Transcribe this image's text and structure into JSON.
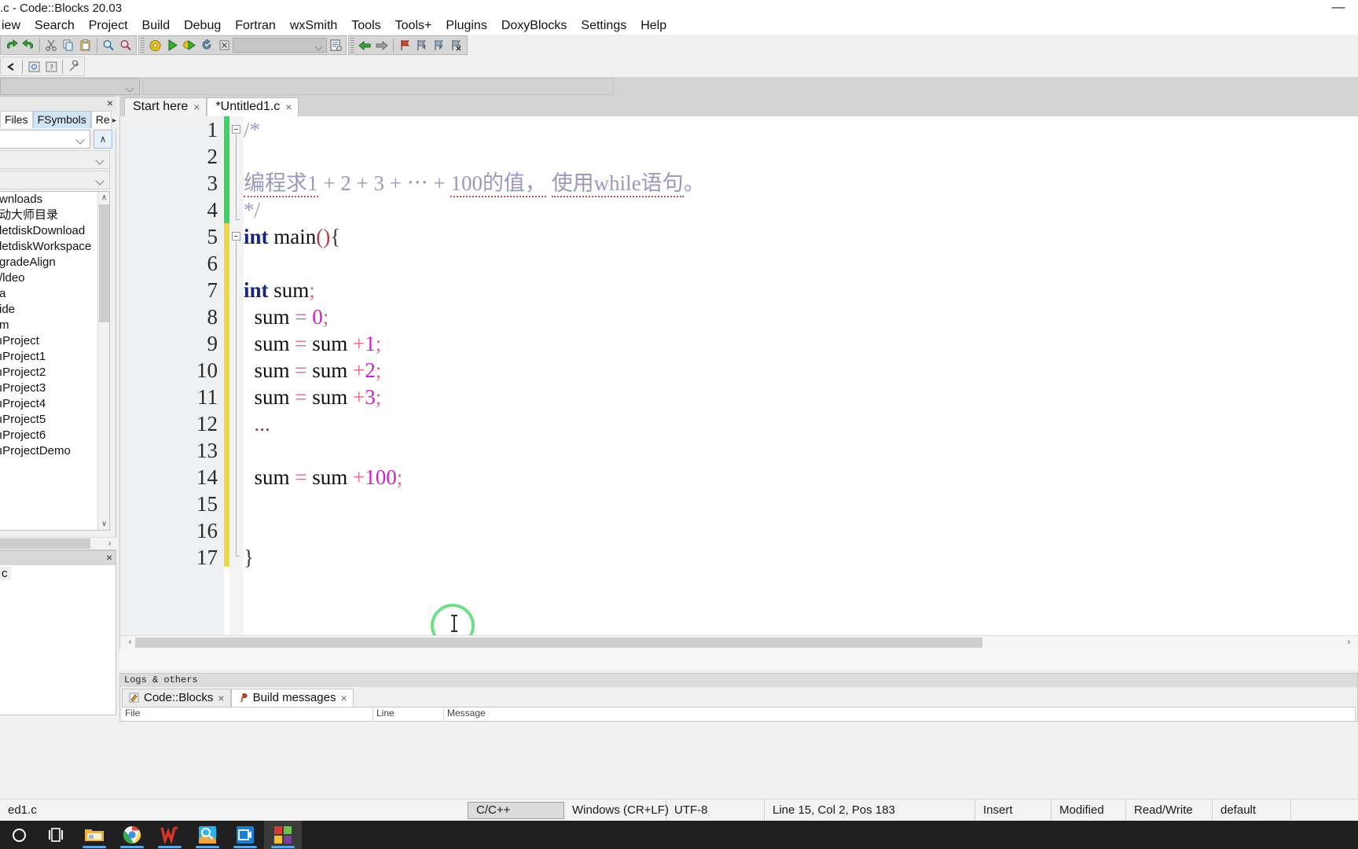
{
  "window": {
    "title": ".c - Code::Blocks 20.03",
    "minimize_label": "—"
  },
  "menubar": {
    "items": [
      {
        "label": "iew"
      },
      {
        "label": "Search"
      },
      {
        "label": "Project"
      },
      {
        "label": "Build"
      },
      {
        "label": "Debug"
      },
      {
        "label": "Fortran"
      },
      {
        "label": "wxSmith"
      },
      {
        "label": "Tools"
      },
      {
        "label": "Tools+"
      },
      {
        "label": "Plugins"
      },
      {
        "label": "DoxyBlocks"
      },
      {
        "label": "Settings"
      },
      {
        "label": "Help"
      }
    ]
  },
  "toolbar": {
    "main_icons": [
      "undo-icon",
      "redo-icon",
      "cut-icon",
      "copy-icon",
      "paste-icon",
      "find-icon",
      "replace-icon"
    ],
    "build_icons": [
      "build-icon",
      "run-icon",
      "build-and-run-icon",
      "rebuild-icon",
      "abort-icon"
    ],
    "build_target_value": "",
    "build_target_icon": "build-targets-icon",
    "nav_icons": [
      "back-icon",
      "forward-icon"
    ],
    "bookmark_icons": [
      "toggle-bookmark-icon",
      "previous-bookmark-icon",
      "next-bookmark-icon",
      "clear-bookmarks-icon"
    ],
    "row2_icons": [
      "debug-continue-icon",
      "debug-info-icon",
      "debug-help-icon",
      "debug-tools-icon"
    ]
  },
  "combo_row": {
    "scope_value": "",
    "function_value": ""
  },
  "management_panel": {
    "caption": "",
    "close_label": "×",
    "tabs": [
      {
        "label": "Files",
        "selected": false
      },
      {
        "label": "FSymbols",
        "selected": true
      },
      {
        "label": "Re",
        "selected": false
      }
    ],
    "scroll_more": "▸",
    "up_button_label": "∧",
    "combo_values": [
      "",
      "",
      ""
    ],
    "tree_items": [
      {
        "label": ""
      },
      {
        "label": "wnloads"
      },
      {
        "label": "动大师目录"
      },
      {
        "label": ""
      },
      {
        "label": "letdiskDownload"
      },
      {
        "label": "letdiskWorkspace"
      },
      {
        "label": "gradeAlign"
      },
      {
        "label": ""
      },
      {
        "label": "/ldeo"
      },
      {
        "label": "a"
      },
      {
        "label": "ide"
      },
      {
        "label": ""
      },
      {
        "label": "m"
      },
      {
        "label": "ıProject"
      },
      {
        "label": "ıProject1"
      },
      {
        "label": "ıProject2"
      },
      {
        "label": "ıProject3"
      },
      {
        "label": "ıProject4"
      },
      {
        "label": "ıProject5"
      },
      {
        "label": "ıProject6"
      },
      {
        "label": "ıProjectDemo"
      }
    ],
    "scroll_up": "∧",
    "scroll_down": "∨",
    "scroll_right": "›"
  },
  "lower_panel": {
    "close_label": "×",
    "item_label": "c"
  },
  "editor": {
    "tabs": [
      {
        "label": "Start here",
        "close": "×",
        "selected": false
      },
      {
        "label": "*Untitled1.c",
        "close": "×",
        "selected": true
      }
    ],
    "fold_markers": [
      1,
      5
    ],
    "change_bar": {
      "saved_color": "#3ad364",
      "unsaved_color": "#ecd844"
    },
    "lines": [
      {
        "n": "1",
        "tokens": [
          {
            "t": "/*",
            "c": "c-comment"
          }
        ]
      },
      {
        "n": "2",
        "tokens": []
      },
      {
        "n": "3",
        "tokens": [
          {
            "t": "编程求1",
            "c": "c-comment squig"
          },
          {
            "t": " + ",
            "c": "c-comment"
          },
          {
            "t": "2",
            "c": "c-comment"
          },
          {
            "t": " + ",
            "c": "c-comment"
          },
          {
            "t": "3",
            "c": "c-comment"
          },
          {
            "t": " + ",
            "c": "c-comment"
          },
          {
            "t": "⋯",
            "c": "c-comment"
          },
          {
            "t": " + ",
            "c": "c-comment"
          },
          {
            "t": "100的值，",
            "c": "c-comment squig"
          },
          {
            "t": " ",
            "c": "c-comment"
          },
          {
            "t": "使用while语句",
            "c": "c-comment squig"
          },
          {
            "t": "。",
            "c": "c-comment"
          }
        ]
      },
      {
        "n": "4",
        "tokens": [
          {
            "t": "*/",
            "c": "c-comment"
          }
        ]
      },
      {
        "n": "5",
        "tokens": [
          {
            "t": "int",
            "c": "c-kw"
          },
          {
            "t": " main",
            "c": "c-ident"
          },
          {
            "t": "()",
            "c": "c-paren"
          },
          {
            "t": "{",
            "c": "c-brace"
          }
        ]
      },
      {
        "n": "6",
        "tokens": []
      },
      {
        "n": "7",
        "tokens": [
          {
            "t": "int",
            "c": "c-kw"
          },
          {
            "t": " sum",
            "c": "c-ident"
          },
          {
            "t": ";",
            "c": "c-op"
          }
        ]
      },
      {
        "n": "8",
        "tokens": [
          {
            "t": "  sum ",
            "c": "c-ident"
          },
          {
            "t": "= ",
            "c": "c-op"
          },
          {
            "t": "0",
            "c": "c-num"
          },
          {
            "t": ";",
            "c": "c-op"
          }
        ]
      },
      {
        "n": "9",
        "tokens": [
          {
            "t": "  sum ",
            "c": "c-ident"
          },
          {
            "t": "= ",
            "c": "c-op"
          },
          {
            "t": "sum ",
            "c": "c-ident"
          },
          {
            "t": "+",
            "c": "c-op"
          },
          {
            "t": "1",
            "c": "c-num"
          },
          {
            "t": ";",
            "c": "c-op"
          }
        ]
      },
      {
        "n": "10",
        "tokens": [
          {
            "t": "  sum ",
            "c": "c-ident"
          },
          {
            "t": "= ",
            "c": "c-op"
          },
          {
            "t": "sum ",
            "c": "c-ident"
          },
          {
            "t": "+",
            "c": "c-op"
          },
          {
            "t": "2",
            "c": "c-num"
          },
          {
            "t": ";",
            "c": "c-op"
          }
        ]
      },
      {
        "n": "11",
        "tokens": [
          {
            "t": "  sum ",
            "c": "c-ident"
          },
          {
            "t": "= ",
            "c": "c-op"
          },
          {
            "t": "sum ",
            "c": "c-ident"
          },
          {
            "t": "+",
            "c": "c-op"
          },
          {
            "t": "3",
            "c": "c-num"
          },
          {
            "t": ";",
            "c": "c-op"
          }
        ]
      },
      {
        "n": "12",
        "tokens": [
          {
            "t": "  ...",
            "c": "c-dots"
          }
        ]
      },
      {
        "n": "13",
        "tokens": []
      },
      {
        "n": "14",
        "tokens": [
          {
            "t": "  sum ",
            "c": "c-ident"
          },
          {
            "t": "= ",
            "c": "c-op"
          },
          {
            "t": "sum ",
            "c": "c-ident"
          },
          {
            "t": "+",
            "c": "c-op"
          },
          {
            "t": "100",
            "c": "c-num"
          },
          {
            "t": ";",
            "c": "c-op"
          }
        ]
      },
      {
        "n": "15",
        "tokens": []
      },
      {
        "n": "16",
        "tokens": []
      },
      {
        "n": "17",
        "tokens": [
          {
            "t": "}",
            "c": "c-brace"
          }
        ]
      }
    ],
    "hscroll": {
      "left_arrow": "‹",
      "right_arrow": "›"
    }
  },
  "logs": {
    "caption": "Logs & others",
    "tabs": [
      {
        "label": "Code::Blocks",
        "close": "×",
        "icon": "note-icon",
        "selected": false
      },
      {
        "label": "Build messages",
        "close": "×",
        "icon": "hammer-icon",
        "selected": true
      }
    ],
    "grid_headers": [
      "File",
      "Line",
      "Message"
    ]
  },
  "statusbar": {
    "file": "ed1.c",
    "language": "C/C++",
    "eol": "Windows (CR+LF)",
    "encoding": "UTF-8",
    "position": "Line 15, Col 2, Pos 183",
    "insert_mode": "Insert",
    "modified": "Modified",
    "access": "Read/Write",
    "profile": "default"
  },
  "taskbar": {
    "items": [
      {
        "name": "cortana-icon"
      },
      {
        "name": "task-view-icon"
      },
      {
        "name": "file-explorer-icon"
      },
      {
        "name": "chrome-icon"
      },
      {
        "name": "wps-icon"
      },
      {
        "name": "photo-search-icon"
      },
      {
        "name": "video-player-icon"
      },
      {
        "name": "codeblocks-icon"
      }
    ]
  }
}
